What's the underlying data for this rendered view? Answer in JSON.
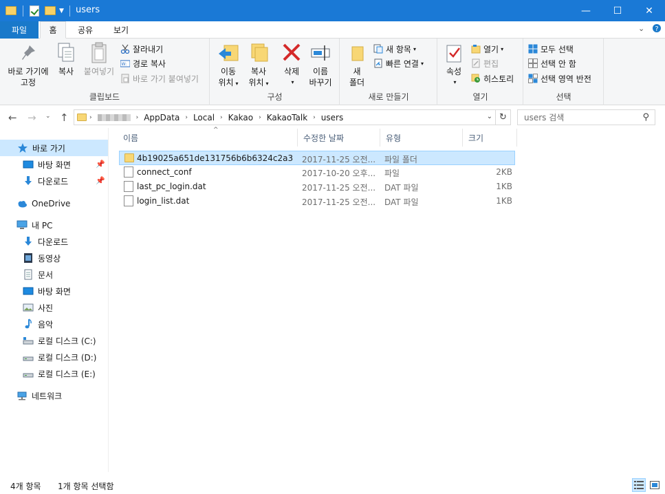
{
  "window": {
    "title": "users",
    "minimize_glyph": "—",
    "maximize_glyph": "☐",
    "close_glyph": "✕"
  },
  "ribbon_tabs": {
    "file": "파일",
    "home": "홈",
    "share": "공유",
    "view": "보기"
  },
  "ribbon": {
    "clipboard": {
      "label": "클립보드",
      "pin": "바로 가기에\n고정",
      "copy": "복사",
      "paste": "붙여넣기",
      "cut": "잘라내기",
      "copy_path": "경로 복사",
      "paste_shortcut": "바로 가기 붙여넣기"
    },
    "organize": {
      "label": "구성",
      "move_to": "이동\n위치",
      "copy_to": "복사\n위치",
      "delete": "삭제",
      "rename": "이름\n바꾸기"
    },
    "new": {
      "label": "새로 만들기",
      "new_folder": "새\n폴더",
      "new_item": "새 항목",
      "easy_access": "빠른 연결"
    },
    "open": {
      "label": "열기",
      "properties": "속성",
      "open": "열기",
      "edit": "편집",
      "history": "히스토리"
    },
    "select": {
      "label": "선택",
      "select_all": "모두 선택",
      "select_none": "선택 안 함",
      "invert": "선택 영역 반전"
    }
  },
  "address": {
    "crumbs": [
      "AppData",
      "Local",
      "Kakao",
      "KakaoTalk",
      "users"
    ],
    "search_placeholder": "users 검색"
  },
  "sidebar": {
    "quick_access": "바로 가기",
    "quick_items": [
      "바탕 화면",
      "다운로드"
    ],
    "onedrive": "OneDrive",
    "this_pc": "내 PC",
    "pc_items": [
      "다운로드",
      "동영상",
      "문서",
      "바탕 화면",
      "사진",
      "음악",
      "로컬 디스크 (C:)",
      "로컬 디스크 (D:)",
      "로컬 디스크 (E:)"
    ],
    "network": "네트워크"
  },
  "columns": {
    "name": "이름",
    "modified": "수정한 날짜",
    "type": "유형",
    "size": "크기"
  },
  "files": [
    {
      "name": "4b19025a651de131756b6b6324c2a31...",
      "modified": "2017-11-25 오전...",
      "type": "파일 폴더",
      "size": "",
      "kind": "folder"
    },
    {
      "name": "connect_conf",
      "modified": "2017-10-20 오후...",
      "type": "파일",
      "size": "2KB",
      "kind": "file"
    },
    {
      "name": "last_pc_login.dat",
      "modified": "2017-11-25 오전...",
      "type": "DAT 파일",
      "size": "1KB",
      "kind": "file"
    },
    {
      "name": "login_list.dat",
      "modified": "2017-11-25 오전...",
      "type": "DAT 파일",
      "size": "1KB",
      "kind": "file"
    }
  ],
  "status": {
    "count": "4개 항목",
    "selected": "1개 항목 선택함"
  }
}
